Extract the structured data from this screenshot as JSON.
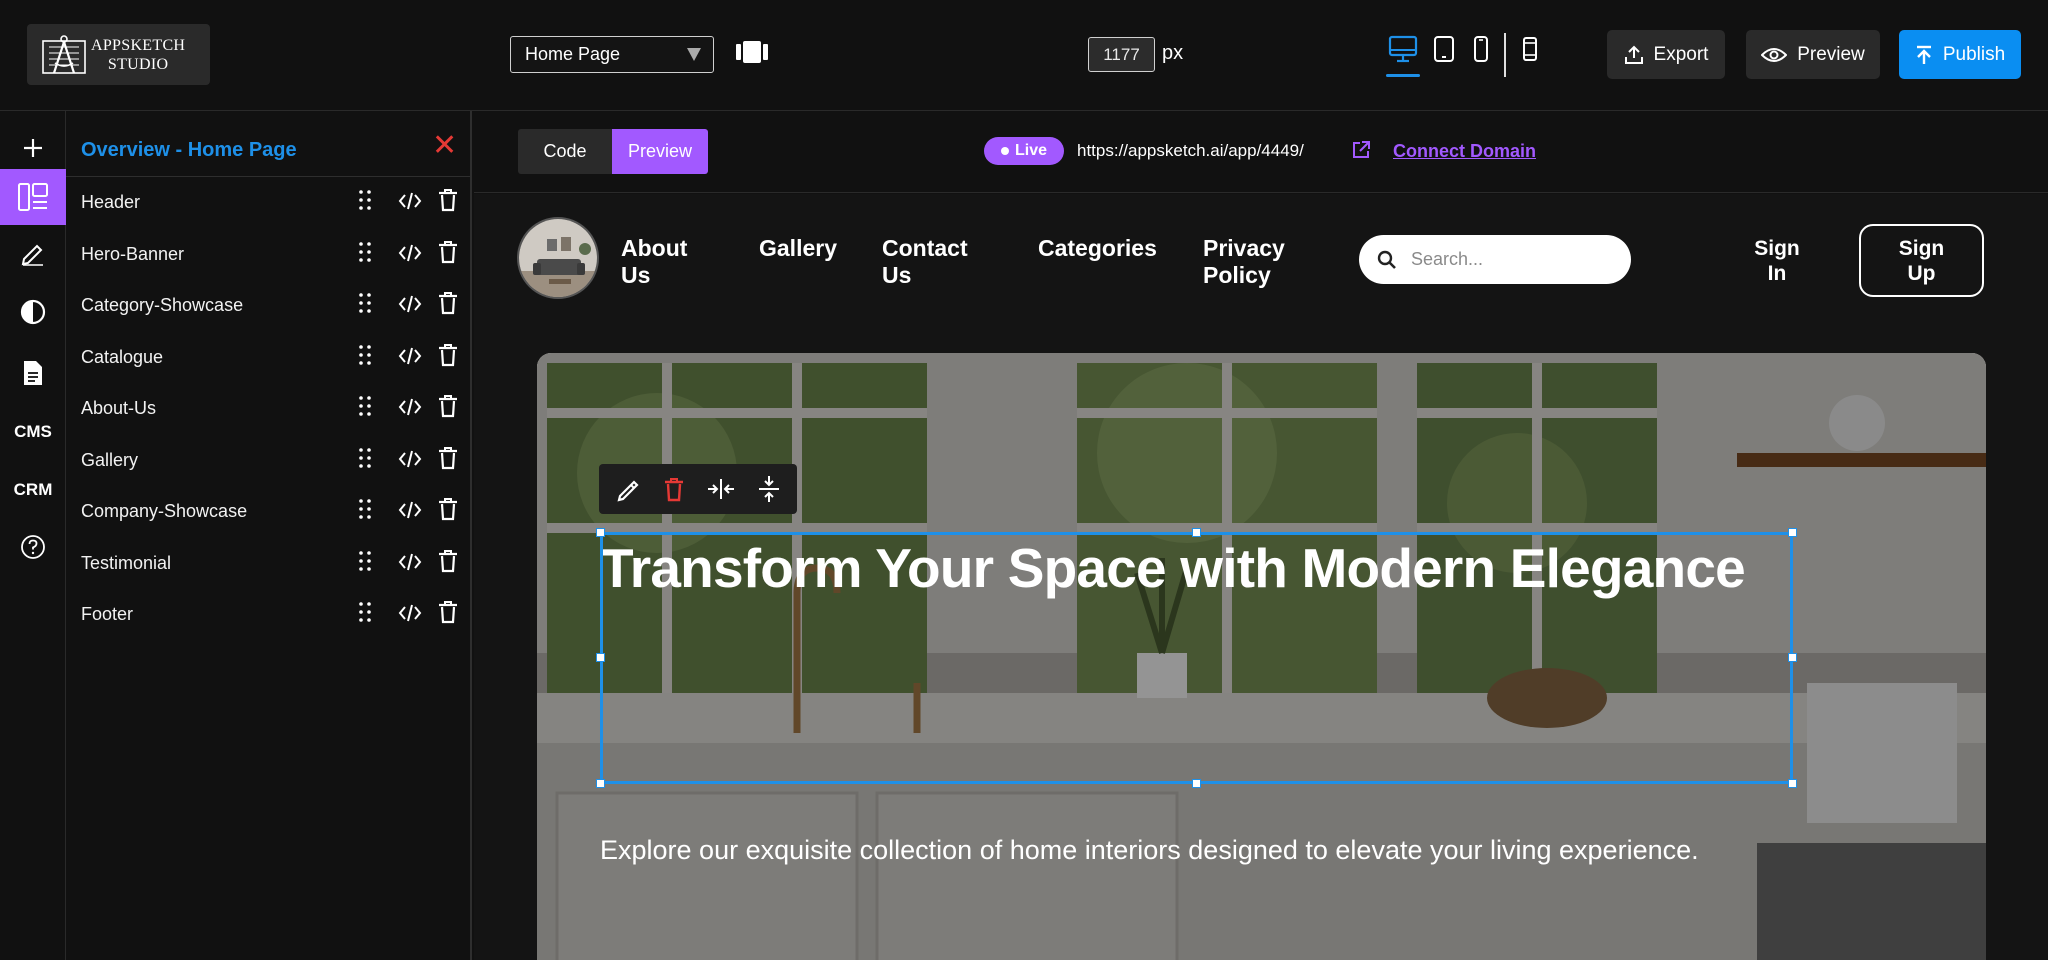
{
  "app": {
    "logo_line1": "APPSKETCH",
    "logo_line2": "STUDIO"
  },
  "topbar": {
    "page_select_value": "Home Page",
    "canvas_width": "1177",
    "canvas_width_unit": "px",
    "devices": [
      "desktop-icon",
      "tablet-icon",
      "mobile-icon",
      "mobile-small-icon"
    ],
    "active_device": "desktop",
    "export_label": "Export",
    "preview_label": "Preview",
    "publish_label": "Publish"
  },
  "rail": {
    "items": [
      "add-icon",
      "layers-icon",
      "edit-icon",
      "theme-icon",
      "pages-icon",
      "CMS",
      "CRM",
      "help-icon"
    ],
    "cms_label": "CMS",
    "crm_label": "CRM",
    "active": "layers"
  },
  "layers_panel": {
    "title": "Overview - Home Page",
    "items": [
      {
        "label": "Header"
      },
      {
        "label": "Hero-Banner"
      },
      {
        "label": "Category-Showcase"
      },
      {
        "label": "Catalogue"
      },
      {
        "label": "About-Us"
      },
      {
        "label": "Gallery"
      },
      {
        "label": "Company-Showcase"
      },
      {
        "label": "Testimonial"
      },
      {
        "label": "Footer"
      }
    ]
  },
  "canvas_bar": {
    "code_label": "Code",
    "preview_label": "Preview",
    "active_mode": "Preview",
    "live_label": "Live",
    "url": "https://appsketch.ai/app/4449/",
    "connect_domain_label": "Connect Domain"
  },
  "site": {
    "nav": {
      "about": "About Us",
      "gallery": "Gallery",
      "contact": "Contact Us",
      "categories": "Categories",
      "privacy": "Privacy Policy",
      "search_placeholder": "Search...",
      "signin": "Sign In",
      "signup": "Sign Up"
    },
    "hero": {
      "title": "Transform Your Space with Modern Elegance",
      "subtitle": "Explore our exquisite collection of home interiors designed to elevate your living experience."
    }
  },
  "colors": {
    "accent_purple": "#a259ff",
    "accent_blue": "#1e90e8",
    "publish_blue": "#0a8ef2",
    "delete_red": "#e53935",
    "background": "#111111"
  }
}
